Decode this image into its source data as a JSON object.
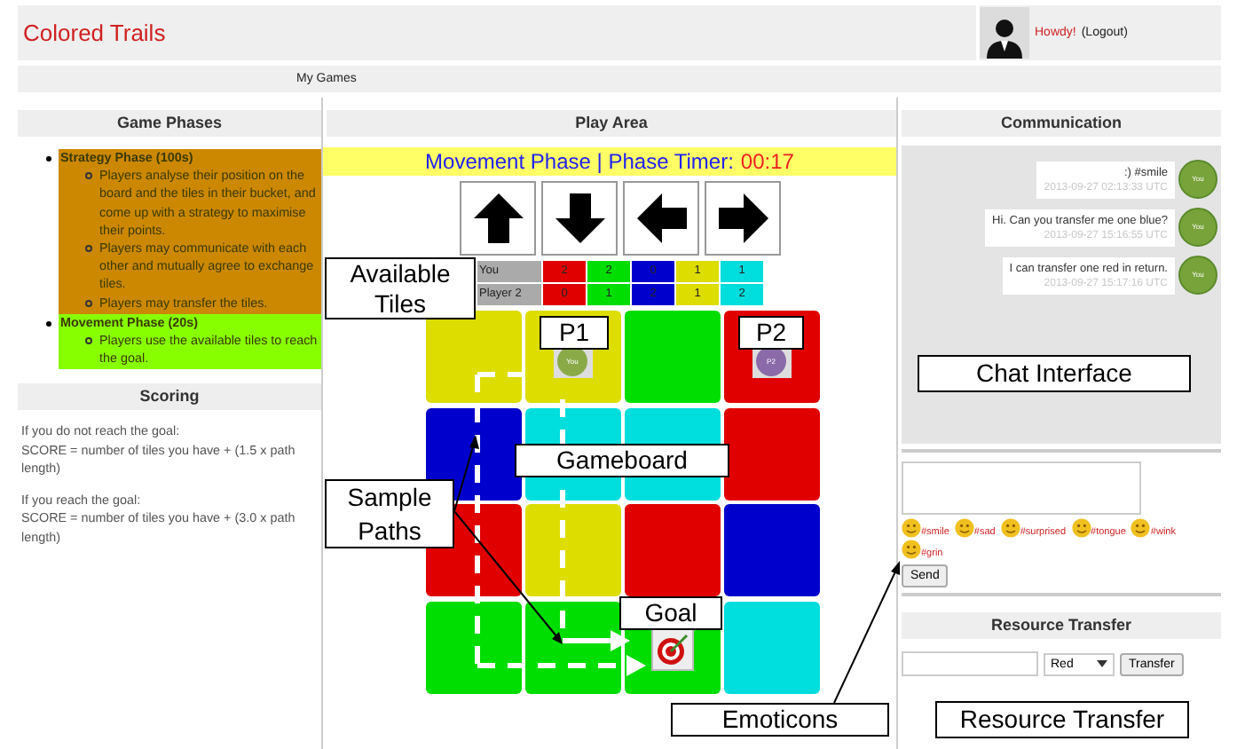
{
  "header": {
    "title": "Colored Trails",
    "greeting": "Howdy!",
    "logout": "(Logout)"
  },
  "nav": [
    {
      "label": "My Games"
    }
  ],
  "game_phases": {
    "title": "Game Phases",
    "phases": [
      {
        "name": "Strategy Phase (100s)",
        "color": "#cc8800",
        "items": [
          "Players analyse their position on the board and the tiles in their bucket, and come up with a strategy to maximise their points.",
          "Players may communicate with each other and mutually agree to exchange tiles.",
          "Players may transfer the tiles."
        ]
      },
      {
        "name": "Movement Phase (20s)",
        "color": "#88ff00",
        "items": [
          "Players use the available tiles to reach the goal."
        ]
      }
    ]
  },
  "scoring": {
    "title": "Scoring",
    "rules": [
      {
        "condition": "If you do not reach the goal:",
        "formula": "SCORE = number of tiles you have + (1.5 x path length)"
      },
      {
        "condition": "If you reach the goal:",
        "formula": "SCORE = number of tiles you have + (3.0 x path length)"
      }
    ]
  },
  "play_area": {
    "title": "Play Area",
    "phase_label": "Movement Phase | Phase Timer:",
    "timer": "00:17",
    "move_buttons": [
      {
        "kind": "up"
      },
      {
        "kind": "down"
      },
      {
        "kind": "left"
      },
      {
        "kind": "right"
      }
    ],
    "tiles": [
      {
        "player": "You",
        "counts": [
          {
            "value": "2",
            "color": "#e00000"
          },
          {
            "value": "2",
            "color": "#00dd00"
          },
          {
            "value": "0",
            "color": "#0000cc"
          },
          {
            "value": "1",
            "color": "#dddd00"
          },
          {
            "value": "1",
            "color": "#00dddd"
          }
        ]
      },
      {
        "player": "Player 2",
        "counts": [
          {
            "value": "0",
            "color": "#e00000"
          },
          {
            "value": "1",
            "color": "#00dd00"
          },
          {
            "value": "2",
            "color": "#0000cc"
          },
          {
            "value": "1",
            "color": "#dddd00"
          },
          {
            "value": "2",
            "color": "#00dddd"
          }
        ]
      }
    ],
    "board": [
      [
        {
          "kind": "plain",
          "color": "#dddd00"
        },
        {
          "kind": "player",
          "color": "#dddd00",
          "token": {
            "label": "You",
            "color": "#8aaa48"
          }
        },
        {
          "kind": "plain",
          "color": "#00dd00"
        },
        {
          "kind": "player",
          "color": "#e00000",
          "token": {
            "label": "P2",
            "color": "#8a6aa8"
          }
        }
      ],
      [
        {
          "kind": "plain",
          "color": "#0000cc"
        },
        {
          "kind": "plain",
          "color": "#00dddd"
        },
        {
          "kind": "plain",
          "color": "#00dddd"
        },
        {
          "kind": "plain",
          "color": "#e00000"
        }
      ],
      [
        {
          "kind": "plain",
          "color": "#e00000"
        },
        {
          "kind": "plain",
          "color": "#dddd00"
        },
        {
          "kind": "plain",
          "color": "#e00000"
        },
        {
          "kind": "plain",
          "color": "#0000cc"
        }
      ],
      [
        {
          "kind": "plain",
          "color": "#00dd00"
        },
        {
          "kind": "plain",
          "color": "#00dd00"
        },
        {
          "kind": "goal",
          "color": "#00dd00"
        },
        {
          "kind": "plain",
          "color": "#00dddd"
        }
      ]
    ]
  },
  "communication": {
    "title": "Communication",
    "messages": [
      {
        "text": ":) #smile",
        "time": "2013-09-27 02:13:33 UTC",
        "avatar": "You"
      },
      {
        "text": "Hi. Can you transfer me one blue?",
        "time": "2013-09-27 15:16:55 UTC",
        "avatar": "You"
      },
      {
        "text": "I can transfer one red in return.",
        "time": "2013-09-27 15:17:16 UTC",
        "avatar": "You"
      }
    ],
    "emoticons": [
      {
        "code": "#smile"
      },
      {
        "code": "#sad"
      },
      {
        "code": "#surprised"
      },
      {
        "code": "#tongue"
      },
      {
        "code": "#wink"
      },
      {
        "code": "#grin"
      }
    ],
    "send": "Send"
  },
  "resource_transfer": {
    "title": "Resource Transfer",
    "resource": "Red",
    "button": "Transfer"
  },
  "annotations": [
    {
      "text": "Available Tiles"
    },
    {
      "text": "P1"
    },
    {
      "text": "P2"
    },
    {
      "text": "Gameboard"
    },
    {
      "text": "Sample Paths"
    },
    {
      "text": "Goal"
    },
    {
      "text": "Emoticons"
    },
    {
      "text": "Chat Interface"
    },
    {
      "text": "Resource Transfer"
    }
  ]
}
